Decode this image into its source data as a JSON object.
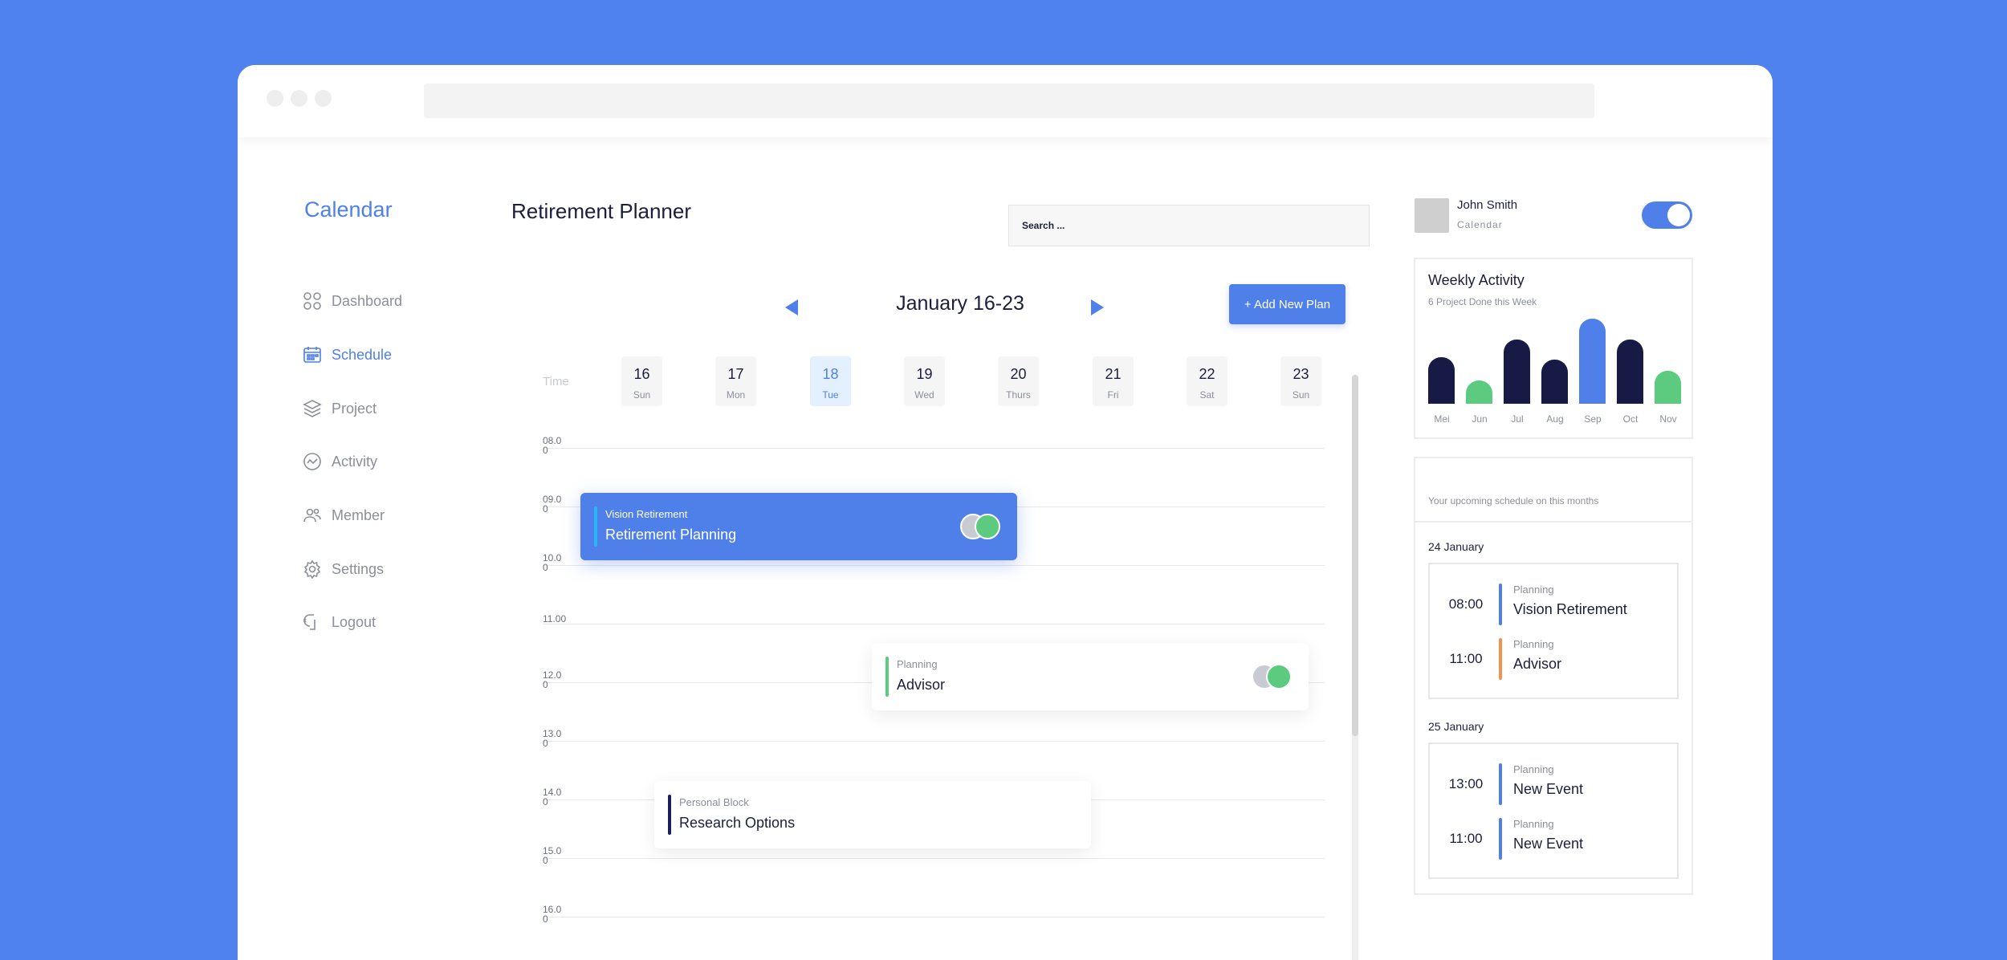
{
  "sidebar": {
    "brand": "Calendar",
    "items": [
      {
        "label": "Dashboard",
        "icon": "dashboard-icon"
      },
      {
        "label": "Schedule",
        "icon": "calendar-icon",
        "active": true
      },
      {
        "label": "Project",
        "icon": "layers-icon"
      },
      {
        "label": "Activity",
        "icon": "activity-icon"
      },
      {
        "label": "Member",
        "icon": "members-icon"
      },
      {
        "label": "Settings",
        "icon": "gear-icon"
      },
      {
        "label": "Logout",
        "icon": "logout-icon"
      }
    ]
  },
  "header": {
    "title": "Retirement Planner",
    "search_placeholder": "Search ..."
  },
  "calendar": {
    "range": "January 16-23",
    "add_button": "+ Add New Plan",
    "time_label": "Time",
    "days": [
      {
        "num": "16",
        "name": "Sun"
      },
      {
        "num": "17",
        "name": "Mon"
      },
      {
        "num": "18",
        "name": "Tue",
        "active": true
      },
      {
        "num": "19",
        "name": "Wed"
      },
      {
        "num": "20",
        "name": "Thurs"
      },
      {
        "num": "21",
        "name": "Fri"
      },
      {
        "num": "22",
        "name": "Sat"
      },
      {
        "num": "23",
        "name": "Sun"
      }
    ],
    "hours": [
      "08.00",
      "09.00",
      "10.00",
      "11.00",
      "12.00",
      "13.00",
      "14.00",
      "15.00",
      "16.00"
    ],
    "events": [
      {
        "category": "Vision Retirement",
        "title": "Retirement Planning",
        "accent": "#29b6f6"
      },
      {
        "category": "Planning",
        "title": "Advisor",
        "accent": "#5ccb80"
      },
      {
        "category": "Personal Block",
        "title": "Research Options",
        "accent": "#1b1f5b"
      }
    ]
  },
  "user": {
    "name": "John Smith",
    "subtitle": "Calendar",
    "toggle_on": true
  },
  "weekly": {
    "title": "Weekly Activity",
    "subtitle": "6 Project Done this Week",
    "chart_data": {
      "type": "bar",
      "categories": [
        "Mei",
        "Jun",
        "Jul",
        "Aug",
        "Sep",
        "Oct",
        "Nov"
      ],
      "values": [
        58,
        29,
        80,
        55,
        106,
        80,
        41
      ],
      "colors": [
        "#161a45",
        "#5ccb80",
        "#161a45",
        "#161a45",
        "#4f7fe8",
        "#161a45",
        "#5ccb80"
      ]
    }
  },
  "schedule": {
    "subtitle": "Your upcoming schedule on this months",
    "groups": [
      {
        "date": "24 January",
        "items": [
          {
            "time": "08:00",
            "category": "Planning",
            "title": "Vision Retirement",
            "accent": "#4f7fe8"
          },
          {
            "time": "11:00",
            "category": "Planning",
            "title": "Advisor",
            "accent": "#f0934e"
          }
        ]
      },
      {
        "date": "25 January",
        "items": [
          {
            "time": "13:00",
            "category": "Planning",
            "title": "New Event",
            "accent": "#4f7fe8"
          },
          {
            "time": "11:00",
            "category": "Planning",
            "title": "New Event",
            "accent": "#4f7fe8"
          }
        ]
      }
    ]
  }
}
